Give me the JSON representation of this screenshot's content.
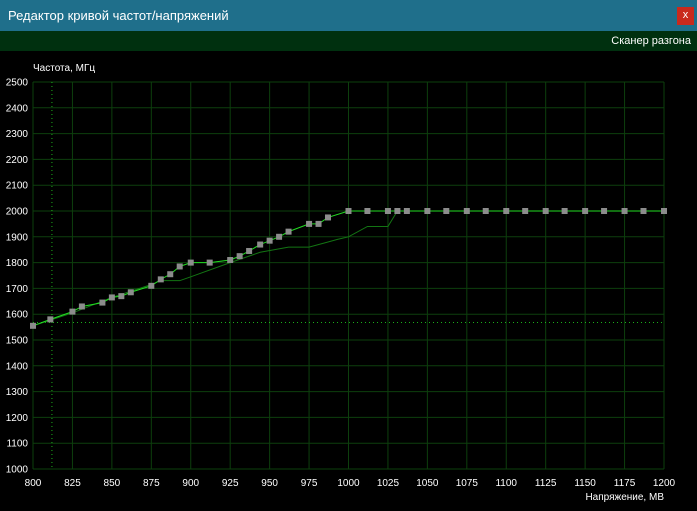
{
  "window": {
    "title": "Редактор кривой частот/напряжений",
    "close_label": "x"
  },
  "toolbar": {
    "scanner_label": "Сканер разгона"
  },
  "colors": {
    "titlebar": "#1f6f8b",
    "toolbar": "#00300f",
    "grid": "#0d3f0d",
    "curve": "#22dd22",
    "reference_curve": "#137513",
    "point": "#8c8c8c",
    "close": "#c92a1d"
  },
  "chart_data": {
    "type": "line",
    "ylabel": "Частота, МГц",
    "xlabel": "Напряжение, МВ",
    "xlim": [
      800,
      1200
    ],
    "ylim": [
      1000,
      2500
    ],
    "x_ticks": [
      800,
      825,
      850,
      875,
      900,
      925,
      950,
      975,
      1000,
      1025,
      1050,
      1075,
      1100,
      1125,
      1150,
      1175,
      1200
    ],
    "y_ticks": [
      1000,
      1100,
      1200,
      1300,
      1400,
      1500,
      1600,
      1700,
      1800,
      1900,
      2000,
      2100,
      2200,
      2300,
      2400,
      2500
    ],
    "grid": true,
    "crosshair": {
      "x": 812,
      "y": 1568
    },
    "series": [
      {
        "points": [
          [
            800,
            1555
          ],
          [
            811,
            1580
          ],
          [
            825,
            1610
          ],
          [
            831,
            1630
          ],
          [
            844,
            1645
          ],
          [
            850,
            1665
          ],
          [
            856,
            1670
          ],
          [
            862,
            1685
          ],
          [
            875,
            1710
          ],
          [
            881,
            1735
          ],
          [
            887,
            1755
          ],
          [
            893,
            1785
          ],
          [
            900,
            1800
          ],
          [
            912,
            1800
          ],
          [
            925,
            1810
          ],
          [
            931,
            1825
          ],
          [
            937,
            1845
          ],
          [
            944,
            1870
          ],
          [
            950,
            1885
          ],
          [
            956,
            1900
          ],
          [
            962,
            1920
          ],
          [
            975,
            1950
          ],
          [
            981,
            1950
          ],
          [
            987,
            1975
          ],
          [
            1000,
            2000
          ],
          [
            1012,
            2000
          ],
          [
            1025,
            2000
          ],
          [
            1031,
            2000
          ],
          [
            1037,
            2000
          ],
          [
            1050,
            2000
          ],
          [
            1062,
            2000
          ],
          [
            1075,
            2000
          ],
          [
            1087,
            2000
          ],
          [
            1100,
            2000
          ],
          [
            1112,
            2000
          ],
          [
            1125,
            2000
          ],
          [
            1137,
            2000
          ],
          [
            1150,
            2000
          ],
          [
            1162,
            2000
          ],
          [
            1175,
            2000
          ],
          [
            1187,
            2000
          ],
          [
            1200,
            2000
          ]
        ]
      },
      {
        "points": [
          [
            800,
            1555
          ],
          [
            825,
            1605
          ],
          [
            850,
            1665
          ],
          [
            875,
            1715
          ],
          [
            881,
            1730
          ],
          [
            893,
            1730
          ],
          [
            900,
            1745
          ],
          [
            925,
            1800
          ],
          [
            944,
            1840
          ],
          [
            962,
            1860
          ],
          [
            975,
            1860
          ],
          [
            987,
            1880
          ],
          [
            993,
            1890
          ],
          [
            1000,
            1900
          ],
          [
            1012,
            1940
          ],
          [
            1025,
            1940
          ],
          [
            1031,
            2000
          ],
          [
            1200,
            2000
          ]
        ]
      }
    ]
  }
}
